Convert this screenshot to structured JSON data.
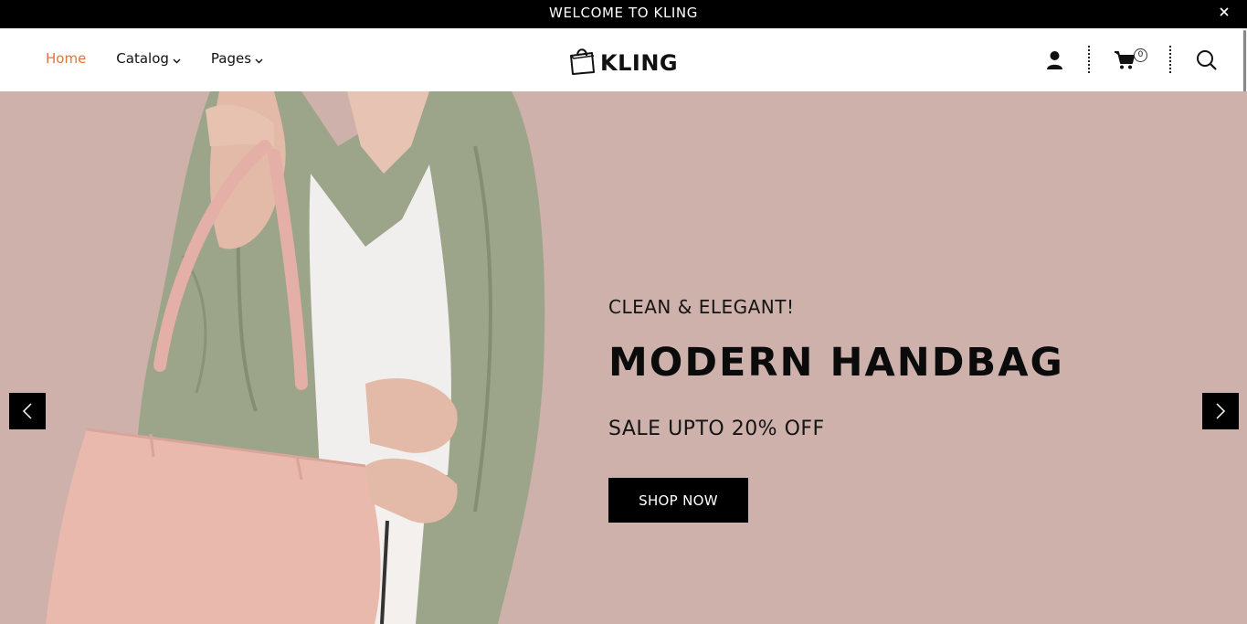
{
  "announcement": {
    "text": "WELCOME TO KLING",
    "close_icon": "close-icon"
  },
  "header": {
    "nav": [
      {
        "label": "Home",
        "active": true,
        "has_dropdown": false
      },
      {
        "label": "Catalog",
        "active": false,
        "has_dropdown": true
      },
      {
        "label": "Pages",
        "active": false,
        "has_dropdown": true
      }
    ],
    "logo": {
      "text": "KLING",
      "icon": "handbag-icon"
    },
    "icons": {
      "account": "user-icon",
      "cart": "cart-icon",
      "search": "search-icon"
    },
    "cart_count": "0"
  },
  "hero": {
    "kicker": "CLEAN & ELEGANT!",
    "headline": "MODERN HANDBAG",
    "subheadline": "SALE UPTO 20% OFF",
    "cta_label": "SHOP NOW",
    "prev_icon": "chevron-left-icon",
    "next_icon": "chevron-right-icon"
  },
  "colors": {
    "accent": "#e0743e",
    "hero_background": "#cdb1aa",
    "announcement_bg": "#000000",
    "button_bg": "#000000"
  }
}
